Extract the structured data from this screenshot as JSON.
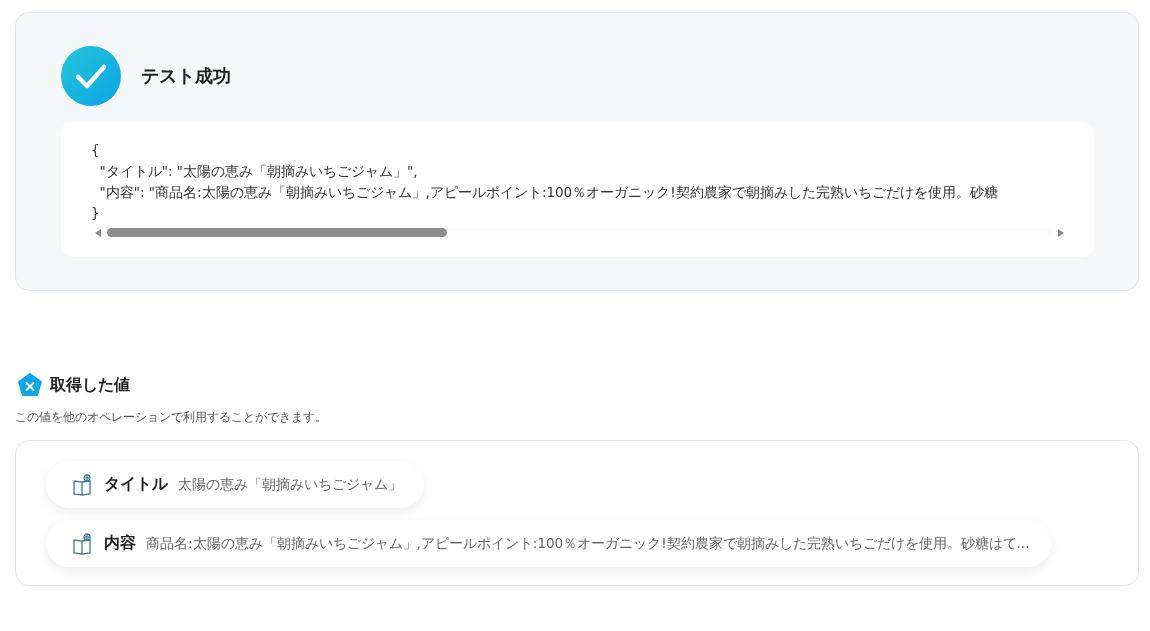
{
  "result": {
    "title": "テスト成功",
    "code_lines": [
      "{",
      "  \"タイトル\": \"太陽の恵み「朝摘みいちごジャム」\",",
      "  \"内容\": \"商品名:太陽の恵み「朝摘みいちごジャム」,アピールポイント:100％オーガニック!契約農家で朝摘みした完熟いちごだけを使用。砂糖",
      "}"
    ]
  },
  "values": {
    "title": "取得した値",
    "description": "この値を他のオペレーションで利用することができます。",
    "items": [
      {
        "label": "タイトル",
        "value": "太陽の恵み「朝摘みいちごジャム」"
      },
      {
        "label": "内容",
        "value": "商品名:太陽の恵み「朝摘みいちごジャム」,アピールポイント:100％オーガニック!契約農家で朝摘みした完熟いちごだけを使用。砂糖はて..."
      }
    ]
  }
}
